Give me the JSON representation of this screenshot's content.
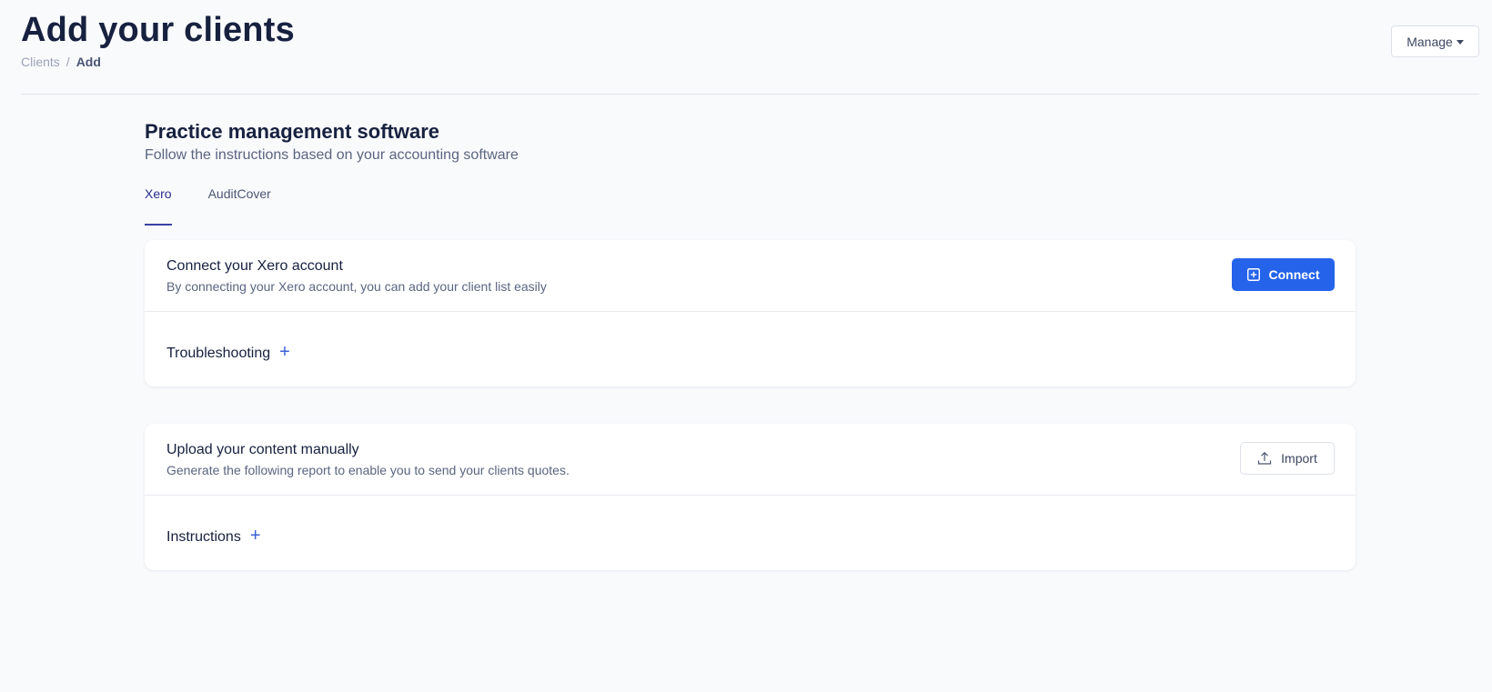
{
  "header": {
    "title": "Add your clients",
    "breadcrumb": {
      "parent": "Clients",
      "separator": "/",
      "current": "Add"
    },
    "manage_label": "Manage"
  },
  "section": {
    "title": "Practice management software",
    "subtitle": "Follow the instructions based on your accounting software",
    "tabs": [
      {
        "label": "Xero",
        "active": true
      },
      {
        "label": "AuditCover",
        "active": false
      }
    ]
  },
  "cards": [
    {
      "title": "Connect your Xero account",
      "description": "By connecting your Xero account, you can add your client list easily",
      "button_label": "Connect",
      "button_icon": "plus-square-icon",
      "expander_label": "Troubleshooting"
    },
    {
      "title": "Upload your content manually",
      "description": "Generate the following report to enable you to send your clients quotes.",
      "button_label": "Import",
      "button_icon": "upload-icon",
      "expander_label": "Instructions"
    }
  ],
  "colors": {
    "primary": "#2563eb",
    "active_tab": "#3b40a8",
    "background": "#f9fafc"
  }
}
